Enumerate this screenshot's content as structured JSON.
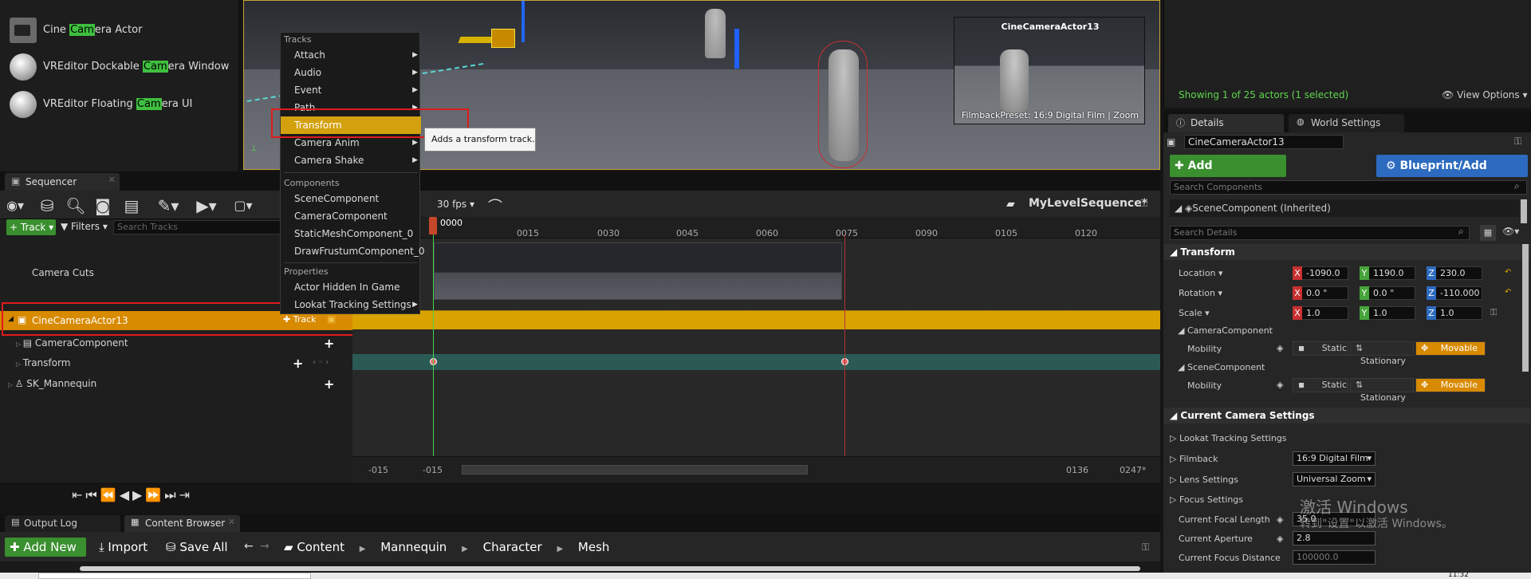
{
  "place_actors": {
    "items": [
      {
        "label_pre": "Cine ",
        "label_hl": "Cam",
        "label_post": "era Actor"
      },
      {
        "label_pre": "VREditor Dockable ",
        "label_hl": "Cam",
        "label_post": "era Window"
      },
      {
        "label_pre": "VREditor Floating ",
        "label_hl": "Cam",
        "label_post": "era UI"
      }
    ]
  },
  "viewport": {
    "pip_title": "CineCameraActor13",
    "pip_caption": "FilmbackPreset: 16:9 Digital Film | Zoom"
  },
  "context_menu": {
    "sections": {
      "tracks": "Tracks",
      "components": "Components",
      "properties": "Properties"
    },
    "tracks": [
      "Attach",
      "Audio",
      "Event",
      "Path",
      "Transform",
      "Camera Anim",
      "Camera Shake"
    ],
    "components": [
      "SceneComponent",
      "CameraComponent",
      "StaticMeshComponent_0",
      "DrawFrustumComponent_0"
    ],
    "properties": [
      "Actor Hidden In Game",
      "Lookat Tracking Settings"
    ],
    "tooltip": "Adds a transform track."
  },
  "sequencer": {
    "tab": "Sequencer",
    "fps": "30 fps",
    "sequence_name": "MyLevelSequence*",
    "track_btn": "Track",
    "filters_btn": "Filters",
    "search_placeholder": "Search Tracks",
    "current_frame": "0000",
    "ticks": [
      "0015",
      "0030",
      "0045",
      "0060",
      "0075",
      "0090",
      "0105",
      "0120"
    ],
    "tracks": {
      "camera_cuts": "Camera Cuts",
      "actor": "CineCameraActor13",
      "actor_track_btn": "Track",
      "camera_component": "CameraComponent",
      "transform": "Transform",
      "mannequin": "SK_Mannequin"
    },
    "range": {
      "start_a": "-015",
      "start_b": "-015",
      "end_a": "0136",
      "end_b": "0247*"
    }
  },
  "bottom": {
    "tabs": [
      "Output Log",
      "Content Browser"
    ],
    "add_new": "Add New",
    "import": "Import",
    "save_all": "Save All",
    "breadcrumb": [
      "Content",
      "Mannequin",
      "Character",
      "Mesh"
    ]
  },
  "outliner": {
    "status": "Showing 1 of 25 actors (1 selected)",
    "view_options": "View Options"
  },
  "details": {
    "tabs": [
      "Details",
      "World Settings"
    ],
    "actor_name": "CineCameraActor13",
    "add_component": "Add Component",
    "blueprint": "Blueprint/Add Script",
    "search_components": "Search Components",
    "scene_component": "SceneComponent (Inherited)",
    "search_details": "Search Details",
    "transform_header": "Transform",
    "location_label": "Location",
    "rotation_label": "Rotation",
    "scale_label": "Scale",
    "location": [
      "-1090.0",
      "1190.0",
      "230.0"
    ],
    "rotation": [
      "0.0 °",
      "0.0 °",
      "-110.000"
    ],
    "scale": [
      "1.0",
      "1.0",
      "1.0"
    ],
    "camera_component": "CameraComponent",
    "scene_component_sub": "SceneComponent",
    "mobility_label": "Mobility",
    "mobility": [
      "Static",
      "Stationary",
      "Movable"
    ],
    "camera_settings_header": "Current Camera Settings",
    "lookat": "Lookat Tracking Settings",
    "filmback": "Filmback",
    "filmback_value": "16:9 Digital Film",
    "lens": "Lens Settings",
    "lens_value": "Universal Zoom",
    "focus": "Focus Settings",
    "focal_length_label": "Current Focal Length",
    "focal_length": "35.0",
    "aperture_label": "Current Aperture",
    "aperture": "2.8",
    "focus_distance_label": "Current Focus Distance",
    "focus_distance": "100000.0"
  },
  "watermark": {
    "line1": "激活 Windows",
    "line2": "转到\"设置\"以激活 Windows。"
  },
  "clock": "11:32",
  "colors": {
    "accent_orange": "#d88a00",
    "green": "#3a8f2e",
    "menu_highlight": "#d3a00e",
    "red_box": "#e01b1b"
  }
}
